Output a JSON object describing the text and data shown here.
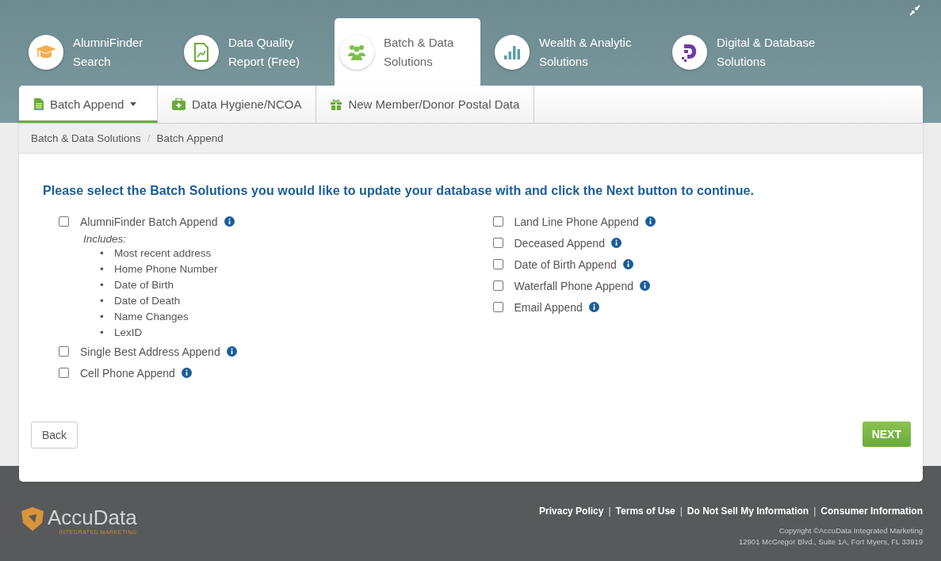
{
  "top_tabs": [
    {
      "label": "AlumniFinder Search",
      "selected": false
    },
    {
      "label": "Data Quality Report (Free)",
      "selected": false
    },
    {
      "label": "Batch & Data Solutions",
      "selected": true
    },
    {
      "label": "Wealth & Analytic Solutions",
      "selected": false
    },
    {
      "label": "Digital & Database Solutions",
      "selected": false
    }
  ],
  "sub_tabs": [
    {
      "label": "Batch Append",
      "dropdown": true,
      "selected": true
    },
    {
      "label": "Data Hygiene/NCOA",
      "dropdown": false,
      "selected": false
    },
    {
      "label": "New Member/Donor Postal Data",
      "dropdown": false,
      "selected": false
    }
  ],
  "breadcrumb": [
    "Batch & Data Solutions",
    "Batch Append"
  ],
  "breadcrumb_separator": "/",
  "bullet": "•",
  "instruction": "Please select the Batch Solutions you would like to update your database with and click the Next button to continue.",
  "left_options": [
    {
      "label": "AlumniFinder Batch Append",
      "checked": false,
      "includes_label": "Includes:",
      "includes": [
        "Most recent address",
        "Home Phone Number",
        "Date of Birth",
        "Date of Death",
        "Name Changes",
        "LexID"
      ]
    },
    {
      "label": "Single Best Address Append",
      "checked": false
    },
    {
      "label": "Cell Phone Append",
      "checked": false
    }
  ],
  "right_options": [
    {
      "label": "Land Line Phone Append",
      "checked": false
    },
    {
      "label": "Deceased Append",
      "checked": false
    },
    {
      "label": "Date of Birth Append",
      "checked": false
    },
    {
      "label": "Waterfall Phone Append",
      "checked": false
    },
    {
      "label": "Email Append",
      "checked": false
    }
  ],
  "buttons": {
    "back": "Back",
    "next": "NEXT"
  },
  "footer": {
    "logo": "AccuData",
    "logo_sub": "INTEGRATED MARKETING",
    "links": [
      "Privacy Policy",
      "Terms of Use",
      "Do Not Sell My Information",
      "Consumer Information"
    ],
    "link_separator": "|",
    "copyright": "Copyright ©AccuData Integrated Marketing",
    "address": "12901 McGregor Blvd., Suite 1A, Fort Myers, FL 33919"
  }
}
